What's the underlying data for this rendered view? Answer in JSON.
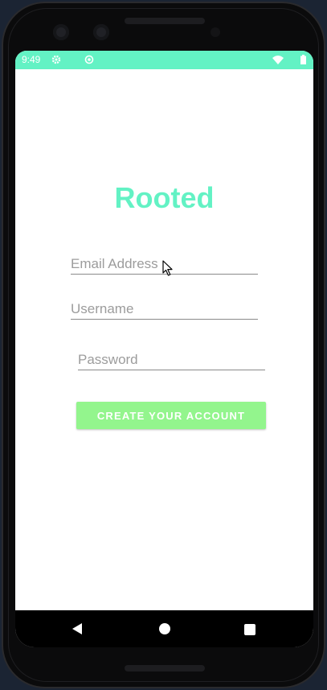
{
  "status_bar": {
    "time": "9:49",
    "icons": [
      "gear-icon",
      "circle-icon",
      "wifi-icon",
      "battery-icon"
    ],
    "background": "#63f2c4"
  },
  "app": {
    "title": "Rooted",
    "title_color": "#63f2c4"
  },
  "form": {
    "email_placeholder": "Email Address",
    "username_placeholder": "Username",
    "password_placeholder": "Password",
    "submit_label": "CREATE YOUR ACCOUNT",
    "button_color": "#93f58d"
  },
  "nav_bar": {
    "icons": [
      "back-icon",
      "home-icon",
      "recent-apps-icon"
    ]
  }
}
